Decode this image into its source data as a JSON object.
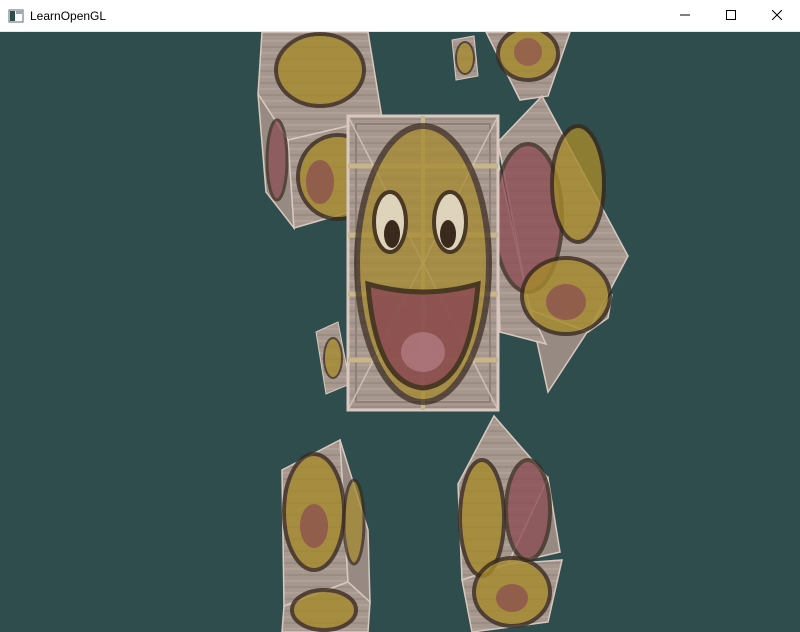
{
  "window": {
    "title": "LearnOpenGL",
    "icon": "app-window-icon",
    "controls": [
      "minimize-icon",
      "maximize-icon",
      "close-icon"
    ]
  },
  "scene": {
    "clear_color": "#2f4d4d",
    "crate_color": "#a7988f",
    "crate_edge_color": "#d8c8c0",
    "face_yellow": "#a58a2c",
    "face_outline": "#3a2a1e",
    "mouth_color": "#8a4a52"
  }
}
